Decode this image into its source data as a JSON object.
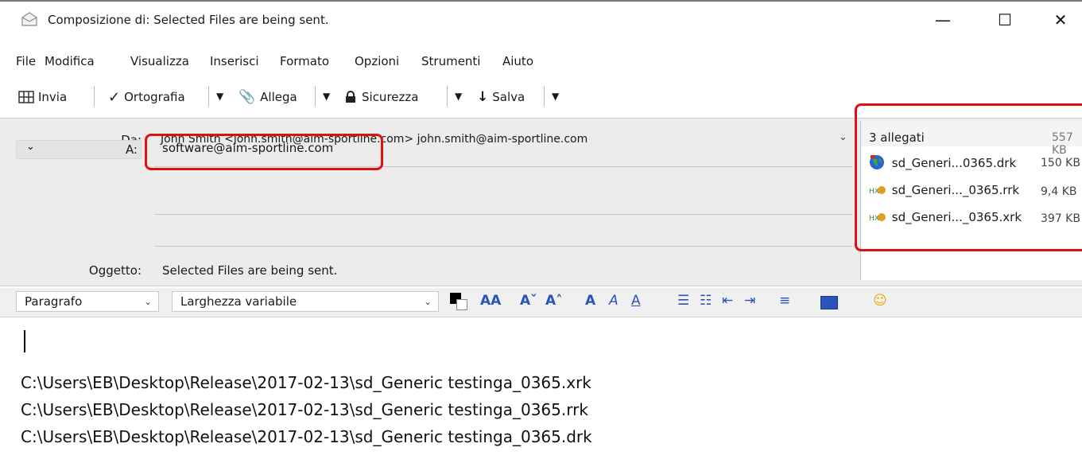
{
  "window": {
    "title": "Composizione di: Selected Files are being sent.",
    "minimize": "—",
    "maximize": "☐",
    "close": "✕"
  },
  "menu": [
    "File",
    "Modifica",
    "Visualizza",
    "Inserisci",
    "Formato",
    "Opzioni",
    "Strumenti",
    "Aiuto"
  ],
  "toolbar": {
    "send": "Invia",
    "spelling": "Ortografia",
    "attach": "Allega",
    "security": "Sicurezza",
    "save": "Salva"
  },
  "header": {
    "from_label": "Da:",
    "from_value": "John Smith <john.smith@aim-sportline.com> john.smith@aim-sportline.com",
    "to_label": "A:",
    "to_value": "software@aim-sportline.com",
    "subject_label": "Oggetto:",
    "subject_value": "Selected Files are being sent."
  },
  "attachments": {
    "count_label": "3 allegati",
    "total_size": "557 KB",
    "items": [
      {
        "name": "sd_Generi...0365.drk",
        "size": "150 KB",
        "icon": "globe-icon"
      },
      {
        "name": "sd_Generi..._0365.rrk",
        "size": "9,4 KB",
        "icon": "file-icon"
      },
      {
        "name": "sd_Generi..._0365.xrk",
        "size": "397 KB",
        "icon": "file-icon"
      }
    ]
  },
  "format": {
    "paragraph": "Paragrafo",
    "font": "Larghezza variabile"
  },
  "body": {
    "lines": [
      "C:\\Users\\EB\\Desktop\\Release\\2017-02-13\\sd_Generic testinga_0365.xrk",
      "C:\\Users\\EB\\Desktop\\Release\\2017-02-13\\sd_Generic testinga_0365.rrk",
      "C:\\Users\\EB\\Desktop\\Release\\2017-02-13\\sd_Generic testinga_0365.drk"
    ]
  },
  "colors": {
    "highlight": "#e01010",
    "header_bg": "#ececec",
    "accent": "#2a55b8"
  }
}
